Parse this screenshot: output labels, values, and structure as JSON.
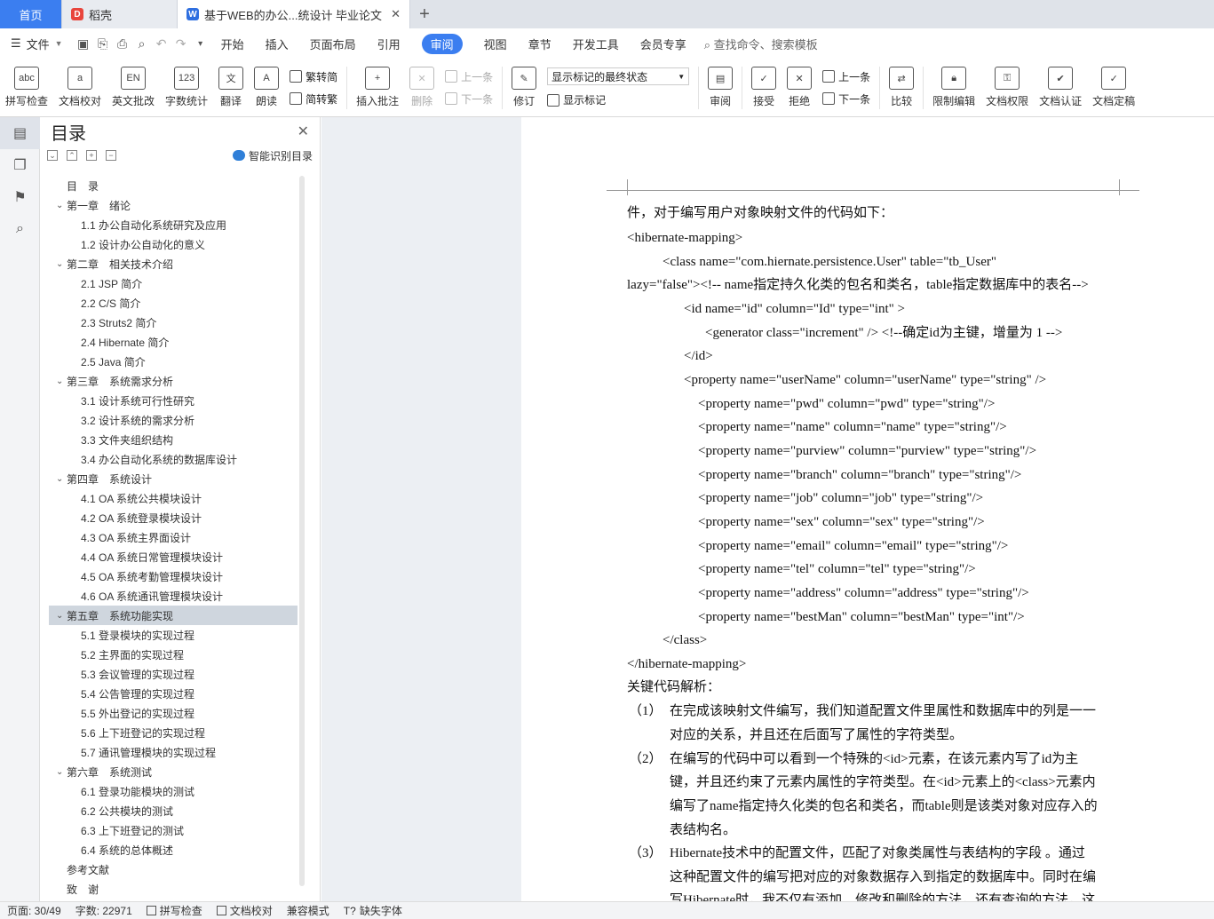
{
  "tabs": {
    "home": "首页",
    "daoke": "稻壳",
    "doc": "基于WEB的办公...统设计 毕业论文",
    "close": "✕",
    "new": "+"
  },
  "menu": {
    "file": "文件",
    "items": [
      "开始",
      "插入",
      "页面布局",
      "引用",
      "审阅",
      "视图",
      "章节",
      "开发工具",
      "会员专享"
    ],
    "active_index": 4,
    "search": "查找命令、搜索模板"
  },
  "ribbon": {
    "spell": "拼写检查",
    "proof": "文档校对",
    "en_review": "英文批改",
    "wordcount": "字数统计",
    "translate": "翻译",
    "read": "朗读",
    "to_trad": "繁转简",
    "to_simp": "简转繁",
    "insert_comment": "插入批注",
    "delete": "删除",
    "prev": "上一条",
    "next": "下一条",
    "track": "修订",
    "markup_state": "显示标记的最终状态",
    "show_markup": "显示标记",
    "review": "审阅",
    "accept": "接受",
    "reject": "拒绝",
    "prev2": "上一条",
    "next2": "下一条",
    "compare": "比较",
    "restrict": "限制编辑",
    "perm": "文档权限",
    "auth": "文档认证",
    "final": "文档定稿"
  },
  "toc": {
    "title": "目录",
    "smart": "智能识别目录",
    "items": [
      {
        "t": "目　录",
        "lv": 0
      },
      {
        "t": "第一章　绪论",
        "lv": 1
      },
      {
        "t": "1.1  办公自动化系统研究及应用",
        "lv": 2
      },
      {
        "t": "1.2  设计办公自动化的意义",
        "lv": 2
      },
      {
        "t": "第二章　相关技术介绍",
        "lv": 1
      },
      {
        "t": "2.1 JSP 简介",
        "lv": 2
      },
      {
        "t": "2.2 C/S 简介",
        "lv": 2
      },
      {
        "t": "2.3 Struts2 简介",
        "lv": 2
      },
      {
        "t": "2.4 Hibernate 简介",
        "lv": 2
      },
      {
        "t": "2.5 Java 简介",
        "lv": 2
      },
      {
        "t": "第三章　系统需求分析",
        "lv": 1
      },
      {
        "t": "3.1  设计系统可行性研究",
        "lv": 2
      },
      {
        "t": "3.2  设计系统的需求分析",
        "lv": 2
      },
      {
        "t": "3.3  文件夹组织结构",
        "lv": 2
      },
      {
        "t": "3.4  办公自动化系统的数据库设计",
        "lv": 2
      },
      {
        "t": "第四章　系统设计",
        "lv": 1
      },
      {
        "t": "4.1 OA 系统公共模块设计",
        "lv": 2
      },
      {
        "t": "4.2 OA 系统登录模块设计",
        "lv": 2
      },
      {
        "t": "4.3 OA 系统主界面设计",
        "lv": 2
      },
      {
        "t": "4.4 OA 系统日常管理模块设计",
        "lv": 2
      },
      {
        "t": "4.5 OA 系统考勤管理模块设计",
        "lv": 2
      },
      {
        "t": "4.6 OA 系统通讯管理模块设计",
        "lv": 2
      },
      {
        "t": "第五章　系统功能实现",
        "lv": 1,
        "sel": true
      },
      {
        "t": "5.1  登录模块的实现过程",
        "lv": 2
      },
      {
        "t": "5.2  主界面的实现过程",
        "lv": 2
      },
      {
        "t": "5.3  会议管理的实现过程",
        "lv": 2
      },
      {
        "t": "5.4  公告管理的实现过程",
        "lv": 2
      },
      {
        "t": "5.5  外出登记的实现过程",
        "lv": 2
      },
      {
        "t": "5.6  上下班登记的实现过程",
        "lv": 2
      },
      {
        "t": "5.7  通讯管理模块的实现过程",
        "lv": 2
      },
      {
        "t": "第六章　系统测试",
        "lv": 1
      },
      {
        "t": "6.1  登录功能模块的测试",
        "lv": 2
      },
      {
        "t": "6.2  公共模块的测试",
        "lv": 2
      },
      {
        "t": "6.3  上下班登记的测试",
        "lv": 2
      },
      {
        "t": "6.4  系统的总体概述",
        "lv": 2
      },
      {
        "t": "参考文献",
        "lv": 0
      },
      {
        "t": "致　谢",
        "lv": 0
      }
    ]
  },
  "doc": {
    "l1": "件，对于编写用户对象映射文件的代码如下：",
    "l2": "<hibernate-mapping>",
    "l3": "<class name=\"com.hiernate.persistence.User\" table=\"tb_User\"",
    "l4": "lazy=\"false\"><!-- name指定持久化类的包名和类名，table指定数据库中的表名-->",
    "l5": "<id name=\"id\" column=\"Id\" type=\"int\" >",
    "l6": "<generator class=\"increment\" /> <!--确定id为主键，增量为 1 -->",
    "l7": "</id>",
    "l8": "<property name=\"userName\" column=\"userName\" type=\"string\" />",
    "l9": "<property name=\"pwd\" column=\"pwd\" type=\"string\"/>",
    "l10": "<property name=\"name\" column=\"name\" type=\"string\"/>",
    "l11": "<property name=\"purview\" column=\"purview\" type=\"string\"/>",
    "l12": "<property name=\"branch\" column=\"branch\" type=\"string\"/>",
    "l13": "<property name=\"job\" column=\"job\" type=\"string\"/>",
    "l14": "<property name=\"sex\" column=\"sex\" type=\"string\"/>",
    "l15": "<property name=\"email\" column=\"email\" type=\"string\"/>",
    "l16": "<property name=\"tel\" column=\"tel\" type=\"string\"/>",
    "l17": "<property name=\"address\"    column=\"address\" type=\"string\"/>",
    "l18": "<property name=\"bestMan\" column=\"bestMan\" type=\"int\"/>",
    "l19": "</class>",
    "l20": "</hibernate-mapping>",
    "l21": "关键代码解析：",
    "n1": "（1）",
    "p1a": "在完成该映射文件编写，我们知道配置文件里属性和数据库中的列是一一",
    "p1b": "对应的关系，并且还在后面写了属性的字符类型。",
    "n2": "（2）",
    "p2a": "在编写的代码中可以看到一个特殊的<id>元素，在该元素内写了id为主",
    "p2b": "键，并且还约束了元素内属性的字符类型。在<id>元素上的<class>元素内",
    "p2c": "编写了name指定持久化类的包名和类名，而table则是该类对象对应存入的",
    "p2d": "表结构名。",
    "n3": "（3）",
    "p3a": "Hibernate技术中的配置文件，匹配了对象类属性与表结构的字段 。通过",
    "p3b": "这种配置文件的编写把对应的对象数据存入到指定的数据库中。同时在编",
    "p3c": "写Hibernate时，我不仅有添加、修改和删除的方法，还有查询的方法，这"
  },
  "status": {
    "page": "页面: 30/49",
    "words": "字数: 22971",
    "spell": "拼写检查",
    "proof": "文档校对",
    "compat": "兼容模式",
    "missing_font": "缺失字体"
  },
  "colors": {
    "accent": "#3b7ef0",
    "toc_selected": "#cfd6de"
  }
}
